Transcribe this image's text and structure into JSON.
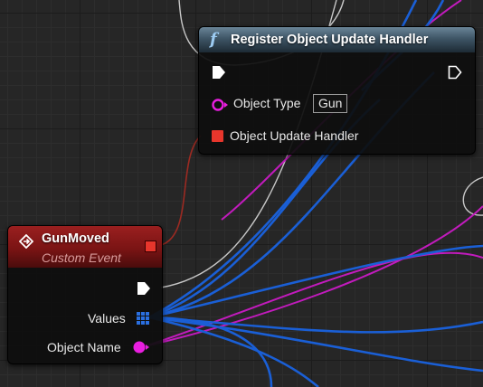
{
  "register_node": {
    "title": "Register Object Update Handler",
    "icon": "function-icon",
    "icon_glyph": "f",
    "header_color": "#3e5566",
    "pins": {
      "object_type_label": "Object Type",
      "object_type_value": "Gun",
      "handler_label": "Object Update Handler"
    }
  },
  "event_node": {
    "title": "GunMoved",
    "subtitle": "Custom Event",
    "icon": "event-icon",
    "header_color": "#7a1414",
    "pins": {
      "values_label": "Values",
      "object_name_label": "Object Name"
    }
  },
  "colors": {
    "exec_pin": "#ffffff",
    "delegate_pin": "#e8362c",
    "object_pin": "#e91ee0",
    "array_pin": "#2a6fe0",
    "wire_blue": "#1a5fd6",
    "wire_magenta": "#c21bbd",
    "wire_white": "#c8c8c8",
    "wire_red": "#9c2a22"
  }
}
